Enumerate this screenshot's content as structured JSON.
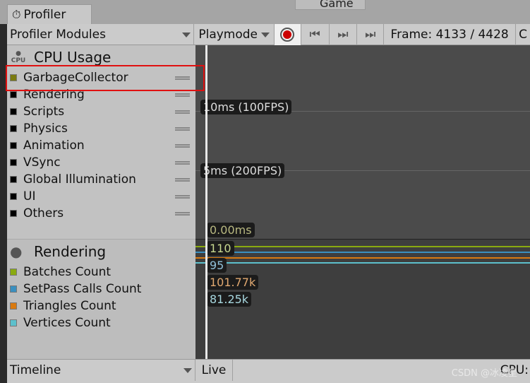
{
  "window": {
    "tab_title": "Profiler",
    "other_tab": "Game"
  },
  "toolbar": {
    "modules_label": "Profiler Modules",
    "playmode_label": "Playmode",
    "frame_label": "Frame: 4133 / 4428",
    "clear_label": "C"
  },
  "cpu_module": {
    "title": "CPU Usage",
    "items": [
      {
        "label": "GarbageCollector",
        "color": "#7a7a10"
      },
      {
        "label": "Rendering",
        "color": "#000000"
      },
      {
        "label": "Scripts",
        "color": "#000000"
      },
      {
        "label": "Physics",
        "color": "#000000"
      },
      {
        "label": "Animation",
        "color": "#000000"
      },
      {
        "label": "VSync",
        "color": "#000000"
      },
      {
        "label": "Global Illumination",
        "color": "#000000"
      },
      {
        "label": "UI",
        "color": "#000000"
      },
      {
        "label": "Others",
        "color": "#000000"
      }
    ],
    "grid_labels": [
      "10ms (100FPS)",
      "5ms (200FPS)"
    ],
    "selected_value": "0.00ms"
  },
  "rendering_module": {
    "title": "Rendering",
    "items": [
      {
        "label": "Batches Count",
        "color": "#8aaa10",
        "value": "110"
      },
      {
        "label": "SetPass Calls Count",
        "color": "#3a8fbf",
        "value": "95"
      },
      {
        "label": "Triangles Count",
        "color": "#d97a10",
        "value": "101.77k"
      },
      {
        "label": "Vertices Count",
        "color": "#5cc0cc",
        "value": "81.25k"
      }
    ]
  },
  "bottom": {
    "view_label": "Timeline",
    "live_label": "Live",
    "cpu_label": "CPU:"
  },
  "watermark": "CSDN @冰凌星"
}
